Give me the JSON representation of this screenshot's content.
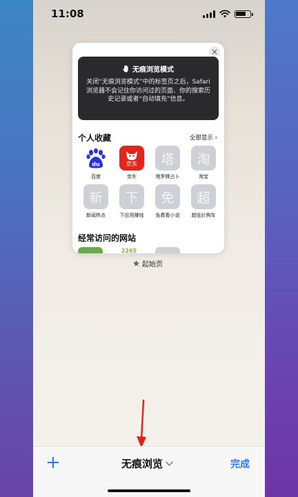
{
  "status_bar": {
    "time": "11:08",
    "battery_level": 0.75
  },
  "tab_card": {
    "private_notice": {
      "title": "无痕浏览模式",
      "description": "关闭“无痕浏览模式”中的标签页之后，Safari 浏览器不会记住你访问过的页面、你的搜索历史记录或者“自动填充”信息。"
    },
    "favorites": {
      "heading": "个人收藏",
      "show_all": "全部显示",
      "items": [
        {
          "label": "百度",
          "glyph": "du"
        },
        {
          "label": "京东",
          "glyph": "京东"
        },
        {
          "label": "塔罗牌占卜",
          "glyph": "塔"
        },
        {
          "label": "淘宝",
          "glyph": "淘"
        },
        {
          "label": "新闻热点",
          "glyph": "新"
        },
        {
          "label": "下应用赚钱",
          "glyph": "下"
        },
        {
          "label": "免费看小说",
          "glyph": "免"
        },
        {
          "label": "超低价购车",
          "glyph": "超"
        }
      ]
    },
    "frequent": {
      "heading": "经常访问的网站",
      "tile2_text": "2265"
    }
  },
  "start_page": {
    "label": "起始页"
  },
  "bottom_bar": {
    "tab_group": "无痕浏览",
    "done": "完成"
  },
  "colors": {
    "accent": "#2a7cf6",
    "arrow": "#e0221b",
    "jd_red": "#e1251b",
    "baidu_blue": "#2932e1"
  }
}
